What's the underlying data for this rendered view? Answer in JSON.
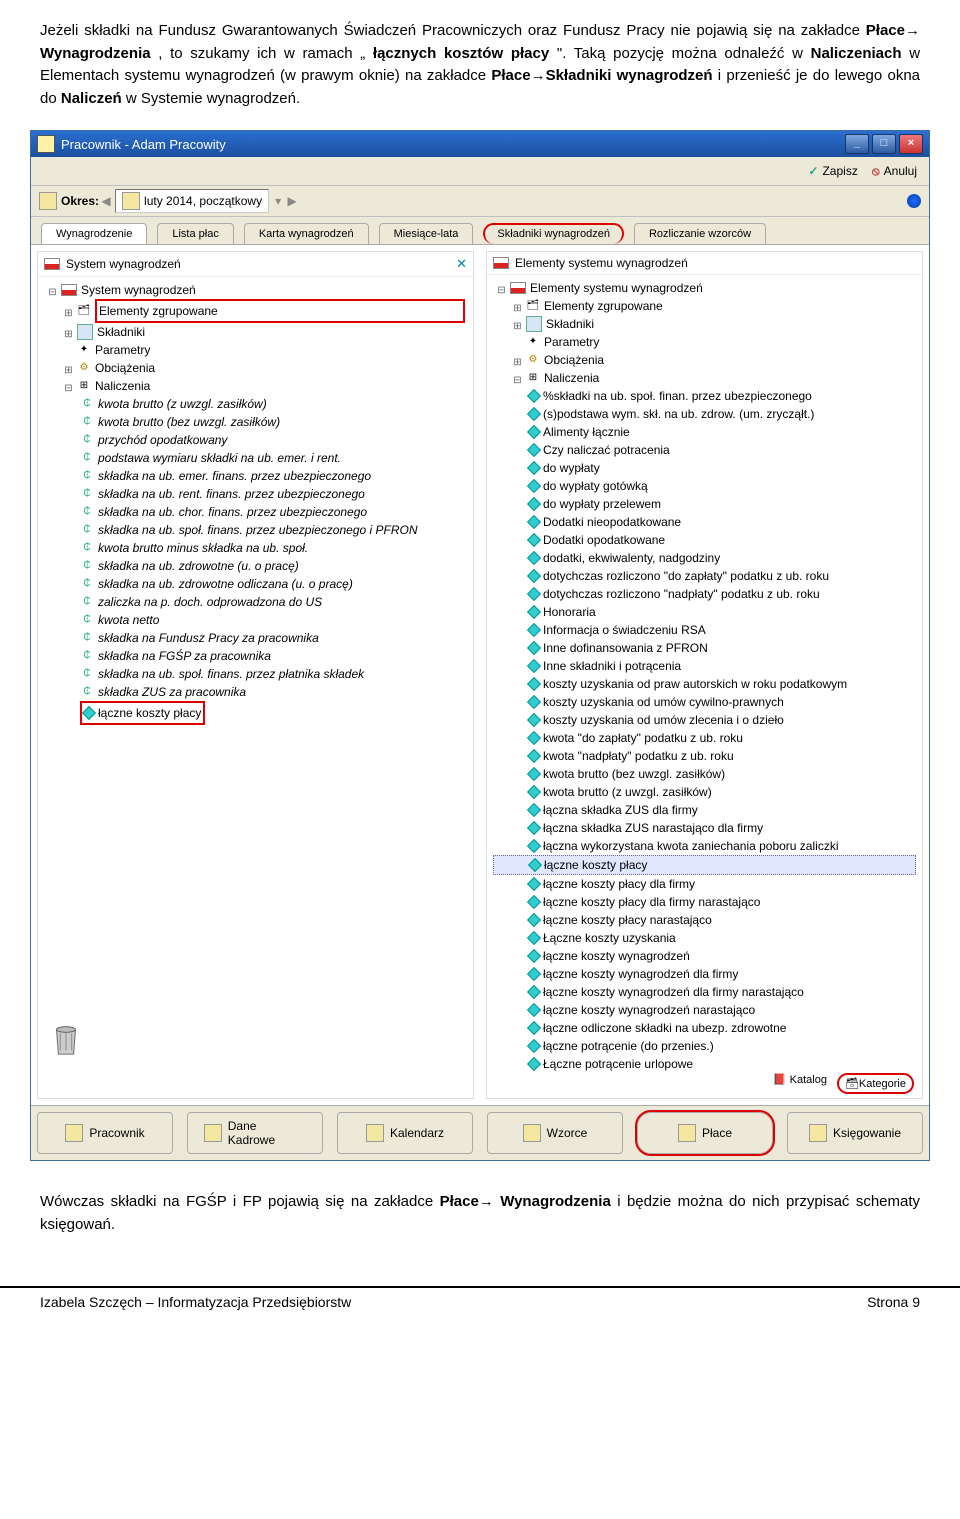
{
  "doc": {
    "para1_a": "Jeżeli składki na Fundusz Gwarantowanych Świadczeń Pracowniczych oraz Fundusz Pracy nie pojawią się na zakładce ",
    "para1_b": "Płace→ Wynagrodzenia",
    "para1_c": ", to szukamy ich w ramach „",
    "para1_d": "łącznych kosztów płacy",
    "para1_e": "\". Taką pozycję można odnaleźć w ",
    "para1_f": "Naliczeniach",
    "para1_g": " w Elementach systemu wynagrodzeń (w prawym oknie) na zakładce ",
    "para1_h": "Płace→Składniki wynagrodzeń",
    "para1_i": " i przenieść je do lewego okna do ",
    "para1_j": "Naliczeń",
    "para1_k": " w Systemie wynagrodzeń.",
    "para2_a": "Wówczas składki na FGŚP i FP pojawią się na zakładce ",
    "para2_b": "Płace→ Wynagrodzenia",
    "para2_c": " i będzie można do nich przypisać schematy księgowań."
  },
  "window_title": "Pracownik - Adam Pracowity",
  "save": "Zapisz",
  "cancel": "Anuluj",
  "period_label": "Okres:",
  "period_value": "luty 2014, początkowy",
  "tabs": {
    "t1": "Wynagrodzenie",
    "t2": "Lista płac",
    "t3": "Karta wynagrodzeń",
    "t4": "Miesiące-lata",
    "t5": "Składniki wynagrodzeń",
    "t6": "Rozliczanie wzorców"
  },
  "left_panel_title": "System wynagrodzeń",
  "left_tree": {
    "n1": "Elementy zgrupowane",
    "n2": "Składniki",
    "n3": "Parametry",
    "n4": "Obciążenia",
    "n5": "Naliczenia",
    "items": [
      "kwota brutto (z uwzgl. zasiłków)",
      "kwota brutto (bez uwzgl. zasiłków)",
      "przychód opodatkowany",
      "podstawa wymiaru składki na ub. emer. i rent.",
      "składka na ub. emer. finans. przez ubezpieczonego",
      "składka na ub. rent. finans. przez ubezpieczonego",
      "składka na ub. chor. finans. przez ubezpieczonego",
      "składka na ub. społ. finans. przez ubezpieczonego i PFRON",
      "kwota brutto minus składka na ub. społ.",
      "składka na ub. zdrowotne (u. o pracę)",
      "składka na ub. zdrowotne odliczana (u. o pracę)",
      "zaliczka na p. doch. odprowadzona do US",
      "kwota netto",
      "składka na Fundusz Pracy za pracownika",
      "składka na FGŚP za pracownika",
      "składka na ub. społ. finans. przez płatnika składek",
      "składka ZUS za pracownika",
      "łączne koszty płacy"
    ]
  },
  "right_panel_title": "Elementy systemu wynagrodzeń",
  "right_tree": {
    "n1": "Elementy zgrupowane",
    "n2": "Składniki",
    "n3": "Parametry",
    "n4": "Obciążenia",
    "n5": "Naliczenia",
    "items": [
      "%składki na ub. społ. finan. przez ubezpieczonego",
      "(s)podstawa wym. skł. na ub. zdrow. (um. zrycząłt.)",
      "Alimenty łącznie",
      "Czy naliczać potracenia",
      "do wypłaty",
      "do wypłaty gotówką",
      "do wypłaty przelewem",
      "Dodatki nieopodatkowane",
      "Dodatki opodatkowane",
      "dodatki, ekwiwalenty, nadgodziny",
      "dotychczas rozliczono \"do zapłaty\" podatku z ub. roku",
      "dotychczas rozliczono \"nadpłaty\" podatku z ub. roku",
      "Honoraria",
      "Informacja o świadczeniu RSA",
      "Inne dofinansowania z PFRON",
      "Inne składniki i potrącenia",
      "koszty uzyskania od praw autorskich w roku podatkowym",
      "koszty uzyskania od umów cywilno-prawnych",
      "koszty uzyskania od umów zlecenia i o dzieło",
      "kwota \"do zapłaty\" podatku z ub. roku",
      "kwota \"nadpłaty\" podatku z ub. roku",
      "kwota brutto (bez uwzgl. zasiłków)",
      "kwota brutto (z uwzgl. zasiłków)",
      "łączna składka ZUS dla firmy",
      "łączna składka ZUS narastająco dla firmy",
      "łączna wykorzystana kwota zaniechania poboru zaliczki",
      "łączne koszty płacy",
      "łączne koszty płacy dla firmy",
      "łączne koszty płacy dla firmy narastająco",
      "łączne koszty płacy narastająco",
      "Łączne koszty uzyskania",
      "łączne koszty wynagrodzeń",
      "łączne koszty wynagrodzeń dla firmy",
      "łączne koszty wynagrodzeń dla firmy narastająco",
      "łączne koszty wynagrodzeń narastająco",
      "łączne odliczone składki na ubezp. zdrowotne",
      "łączne potrącenie (do przenies.)",
      "Łączne potrącenie urlopowe"
    ]
  },
  "panel_footer": {
    "katalog": "Katalog",
    "kategorie": "Kategorie"
  },
  "bottom_tabs": {
    "t1": "Pracownik",
    "t2": "Dane Kadrowe",
    "t3": "Kalendarz",
    "t4": "Wzorce",
    "t5": "Płace",
    "t6": "Księgowanie"
  },
  "footer": {
    "left": "Izabela Szczęch – Informatyzacja Przedsiębiorstw",
    "right": "Strona 9"
  }
}
